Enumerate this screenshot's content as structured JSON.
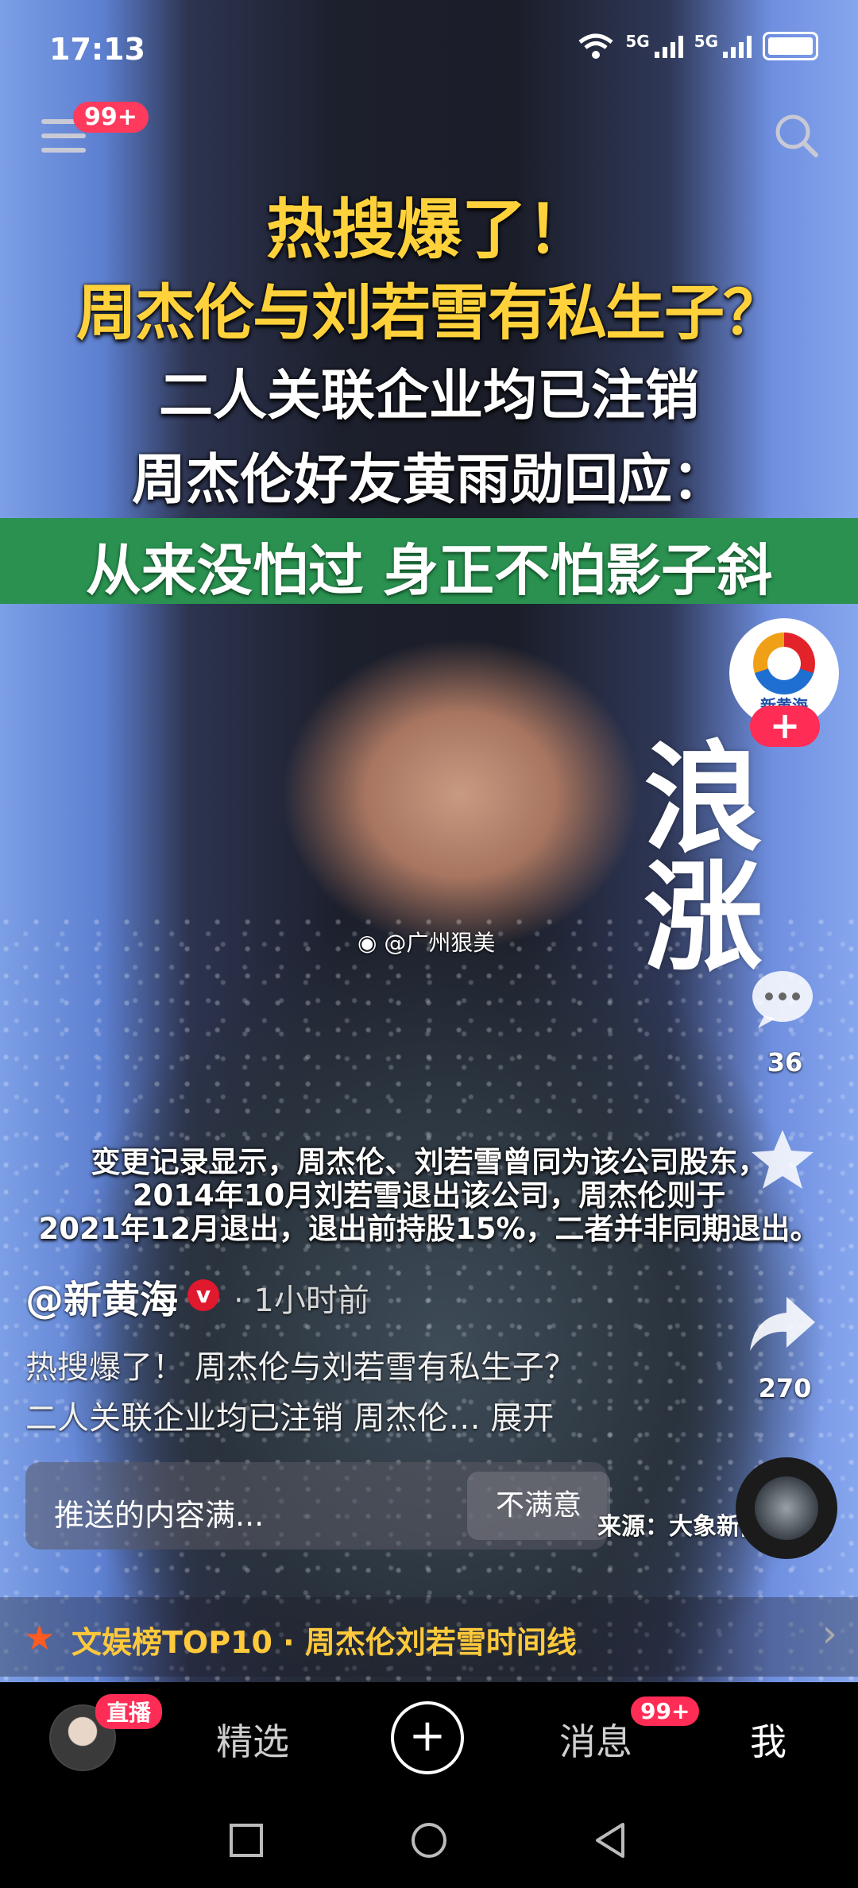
{
  "status_bar": {
    "time": "17:13",
    "network_1": "5G",
    "network_2": "5G"
  },
  "top": {
    "menu_badge": "99+"
  },
  "headline": {
    "line1": "热搜爆了！",
    "line2": "周杰伦与刘若雪有私生子？",
    "line3": "二人关联企业均已注销",
    "line4": "周杰伦好友黄雨勋回应：",
    "line5": "从来没怕过 身正不怕影子斜"
  },
  "channel": {
    "logo_text": "新黄海",
    "follow_label": "+"
  },
  "overlay": {
    "calligraphy": "浪涨",
    "watermark": "@广州狠美"
  },
  "actions": {
    "comment_count": "36",
    "share_count": "270"
  },
  "caption": {
    "line1": "变更记录显示，周杰伦、刘若雪曾同为该公司股东，",
    "line2": "2014年10月刘若雪退出该公司，周杰伦则于",
    "line3": "2021年12月退出，退出前持股15%，二者并非同期退出。"
  },
  "post": {
    "author": "@新黄海",
    "verified": "v",
    "time_ago": "· 1小时前",
    "desc_line1": "热搜爆了！ 周杰伦与刘若雪有私生子？",
    "desc_line2": "二人关联企业均已注销 周杰伦… 展开"
  },
  "feedback": {
    "question": "推送的内容满...",
    "dissatisfied": "不满意",
    "source": "来源：大象新闻"
  },
  "topic": {
    "text": "文娱榜TOP10 · 周杰伦刘若雪时间线",
    "arrow": "›"
  },
  "tabbar": {
    "live_badge": "直播",
    "tab_featured": "精选",
    "plus": "+",
    "tab_messages": "消息",
    "messages_badge": "99+",
    "tab_me": "我"
  }
}
